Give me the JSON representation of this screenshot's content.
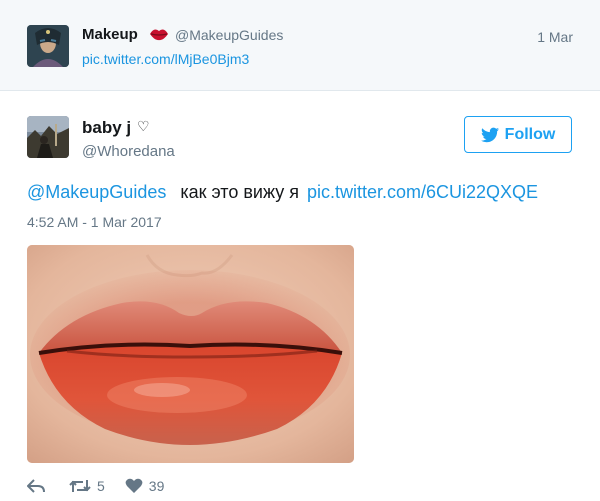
{
  "quoted": {
    "name": "Makeup",
    "handle": "@MakeupGuides",
    "date": "1 Mar",
    "link": "pic.twitter.com/lMjBe0Bjm3",
    "emoji_icon": "lips-kiss-icon"
  },
  "tweet": {
    "name": "baby j",
    "name_suffix": "♡",
    "handle": "@Whoredana",
    "follow_label": "Follow",
    "mention": "@MakeupGuides",
    "text": "как это вижу я",
    "link": "pic.twitter.com/6CUi22QXQE",
    "timestamp": "4:52 AM - 1 Mar 2017"
  },
  "actions": {
    "reply_icon": "reply-icon",
    "retweet_icon": "retweet-icon",
    "retweet_count": "5",
    "like_icon": "heart-icon",
    "like_count": "39"
  },
  "colors": {
    "accent": "#1da1f2",
    "link": "#1b95e0",
    "muted": "#657786",
    "quoted_bg": "#f5f8fa"
  }
}
